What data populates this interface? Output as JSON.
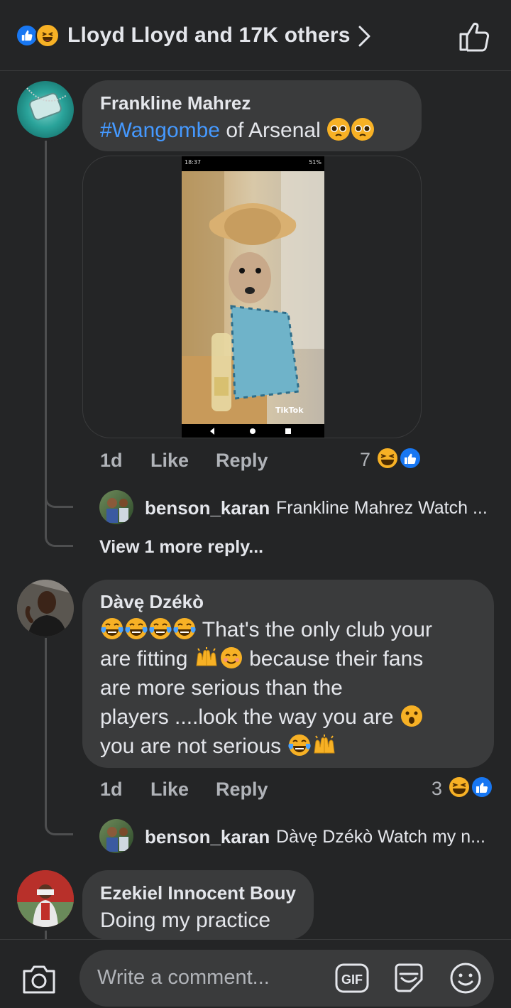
{
  "header": {
    "title": "Lloyd Lloyd and 17K others",
    "reactions": [
      "like",
      "haha"
    ]
  },
  "comments": [
    {
      "author": "Frankline Mahrez",
      "hashtag": "#Wangombe",
      "text_after": " of Arsenal",
      "emojis": [
        "pleading-face",
        "pleading-face"
      ],
      "media": {
        "type": "video-screenshot",
        "status_time": "18:37",
        "status_right": "51%",
        "watermark": "TikTok"
      },
      "time": "1d",
      "like_label": "Like",
      "reply_label": "Reply",
      "reaction_count": "7",
      "reactions": [
        "haha",
        "like"
      ],
      "reply_preview": {
        "name": "benson_karan",
        "text": "Frankline Mahrez Watch ..."
      },
      "view_more": "View 1 more reply..."
    },
    {
      "author": "Dàvę Dzékò",
      "text_lines": [
        "That's the only club your",
        "are fitting",
        "because their fans",
        "are more serious than the",
        "players ....look the way you are",
        "you are not serious"
      ],
      "time": "1d",
      "like_label": "Like",
      "reply_label": "Reply",
      "reaction_count": "3",
      "reactions": [
        "haha",
        "like"
      ],
      "reply_preview": {
        "name": "benson_karan",
        "text": "Dàvę Dzékò Watch my n..."
      }
    },
    {
      "author": "Ezekiel Innocent Bouy",
      "text": "Doing my practice"
    }
  ],
  "composer": {
    "placeholder": "Write a comment...",
    "gif_label": "GIF",
    "icons": [
      "camera-icon",
      "gif-icon",
      "sticker-icon",
      "emoji-icon"
    ]
  },
  "colors": {
    "background": "#242526",
    "bubble": "#3a3b3c",
    "link": "#4599ff",
    "like_blue": "#1877f2",
    "haha_yellow": "#f7b125"
  }
}
